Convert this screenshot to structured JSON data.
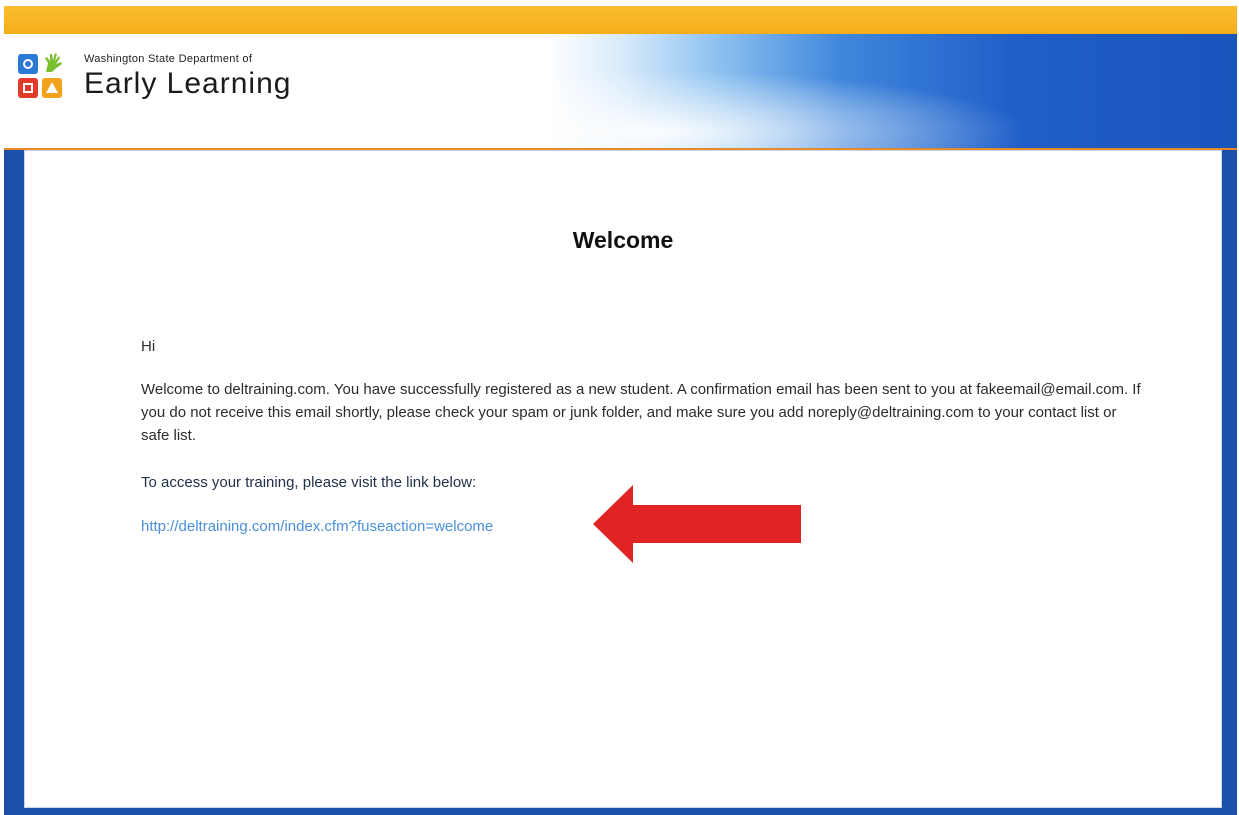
{
  "header": {
    "org_subtitle": "Washington State Department of",
    "org_title": "Early Learning"
  },
  "main": {
    "title": "Welcome",
    "greeting": "Hi",
    "paragraph": "Welcome to deltraining.com. You have successfully registered as a new student. A confirmation email has been sent to you at fakeemail@email.com. If you do not receive this email shortly, please check your spam or junk folder, and make sure you add noreply@deltraining.com to your contact list or safe list.",
    "access_text": "To access your training, please visit the link below:",
    "link_text": "http://deltraining.com/index.cfm?fuseaction=welcome"
  },
  "colors": {
    "top_stripe": "#f5ad1a",
    "frame_blue": "#1c4fa8",
    "link": "#4a90d9",
    "arrow": "#e02424"
  },
  "icons": [
    "logo-blue-circle-icon",
    "logo-green-hand-icon",
    "logo-red-square-icon",
    "logo-orange-triangle-icon",
    "red-arrow-icon"
  ]
}
